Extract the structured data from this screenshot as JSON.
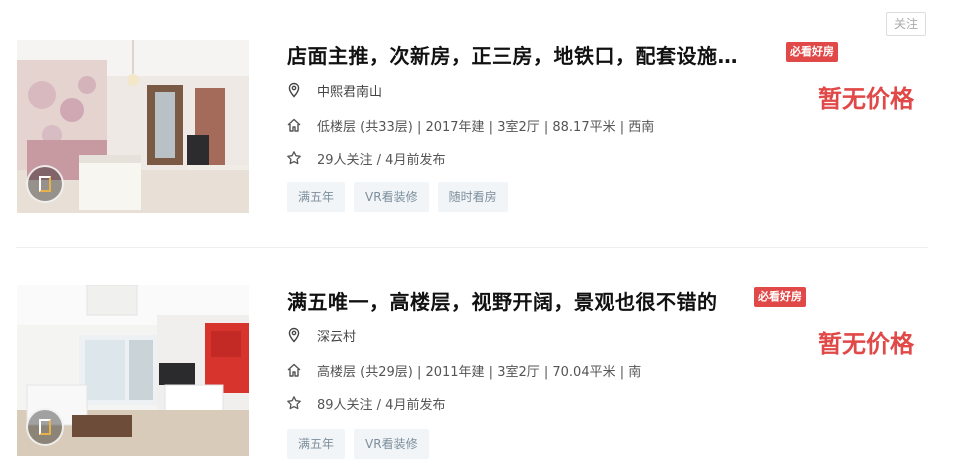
{
  "follow_button": "关注",
  "listings": [
    {
      "title": "店面主推，次新房，正三房，地铁口，配套设施…",
      "badge": "必看好房",
      "price": "暂无价格",
      "community": "中熙君南山",
      "house_info": "低楼层 (共33层) | 2017年建 | 3室2厅 | 88.17平米 | 西南",
      "follow_info": "29人关注 / 4月前发布",
      "tags": [
        "满五年",
        "VR看装修",
        "随时看房"
      ]
    },
    {
      "title": "满五唯一，高楼层，视野开阔，景观也很不错的",
      "badge": "必看好房",
      "price": "暂无价格",
      "community": "深云村",
      "house_info": "高楼层 (共29层) | 2011年建 | 3室2厅 | 70.04平米 | 南",
      "follow_info": "89人关注 / 4月前发布",
      "tags": [
        "满五年",
        "VR看装修"
      ]
    }
  ],
  "icons": {
    "location": "location-pin-icon",
    "house": "house-icon",
    "star": "star-icon",
    "vr": "vr-3d-icon"
  },
  "colors": {
    "accent": "#e14848",
    "tag_bg": "#f1f5f8",
    "tag_text": "#7d8e9c"
  }
}
